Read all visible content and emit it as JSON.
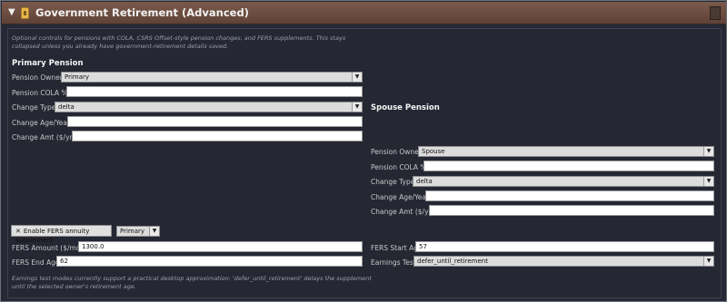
{
  "header": {
    "title": "Government Retirement (Advanced)",
    "collapse_glyph": "▼"
  },
  "intro_note": "Optional controls for pensions with COLA, CSRS Offset-style pension changes, and FERS supplements. This stays collapsed unless you already have government-retirement details saved.",
  "primary": {
    "title": "Primary Pension",
    "owner_label": "Pension Owner:",
    "owner_value": "Primary",
    "cola_label": "Pension COLA %:",
    "cola_value": "",
    "change_type_label": "Change Type:",
    "change_type_value": "delta",
    "change_age_label": "Change Age/Year:",
    "change_age_value": "",
    "change_amt_label": "Change Amt ($/yr):",
    "change_amt_value": ""
  },
  "spouse": {
    "title": "Spouse Pension",
    "owner_label": "Pension Owner:",
    "owner_value": "Spouse",
    "cola_label": "Pension COLA %:",
    "cola_value": "",
    "change_type_label": "Change Type:",
    "change_type_value": "delta",
    "change_age_label": "Change Age/Year:",
    "change_age_value": "",
    "change_amt_label": "Change Amt ($/yr):",
    "change_amt_value": ""
  },
  "fers": {
    "enable_label": "Enable FERS annuity supplement",
    "enable_mark": "✕",
    "owner_value": "Primary",
    "amount_label": "FERS Amount ($/mo):",
    "amount_value": "1300.0",
    "end_age_label": "FERS End Age:",
    "end_age_value": "62",
    "start_age_label": "FERS Start Age:",
    "start_age_value": "57",
    "earnings_test_label": "Earnings Test:",
    "earnings_test_value": "defer_until_retirement"
  },
  "footer_note": "Earnings test modes currently support a practical desktop approximation: 'defer_until_retirement' delays the supplement until the selected owner's retirement age.",
  "colors": {
    "header": "#6b4c3f",
    "panel": "#262835",
    "icon": "#e8b84a"
  }
}
